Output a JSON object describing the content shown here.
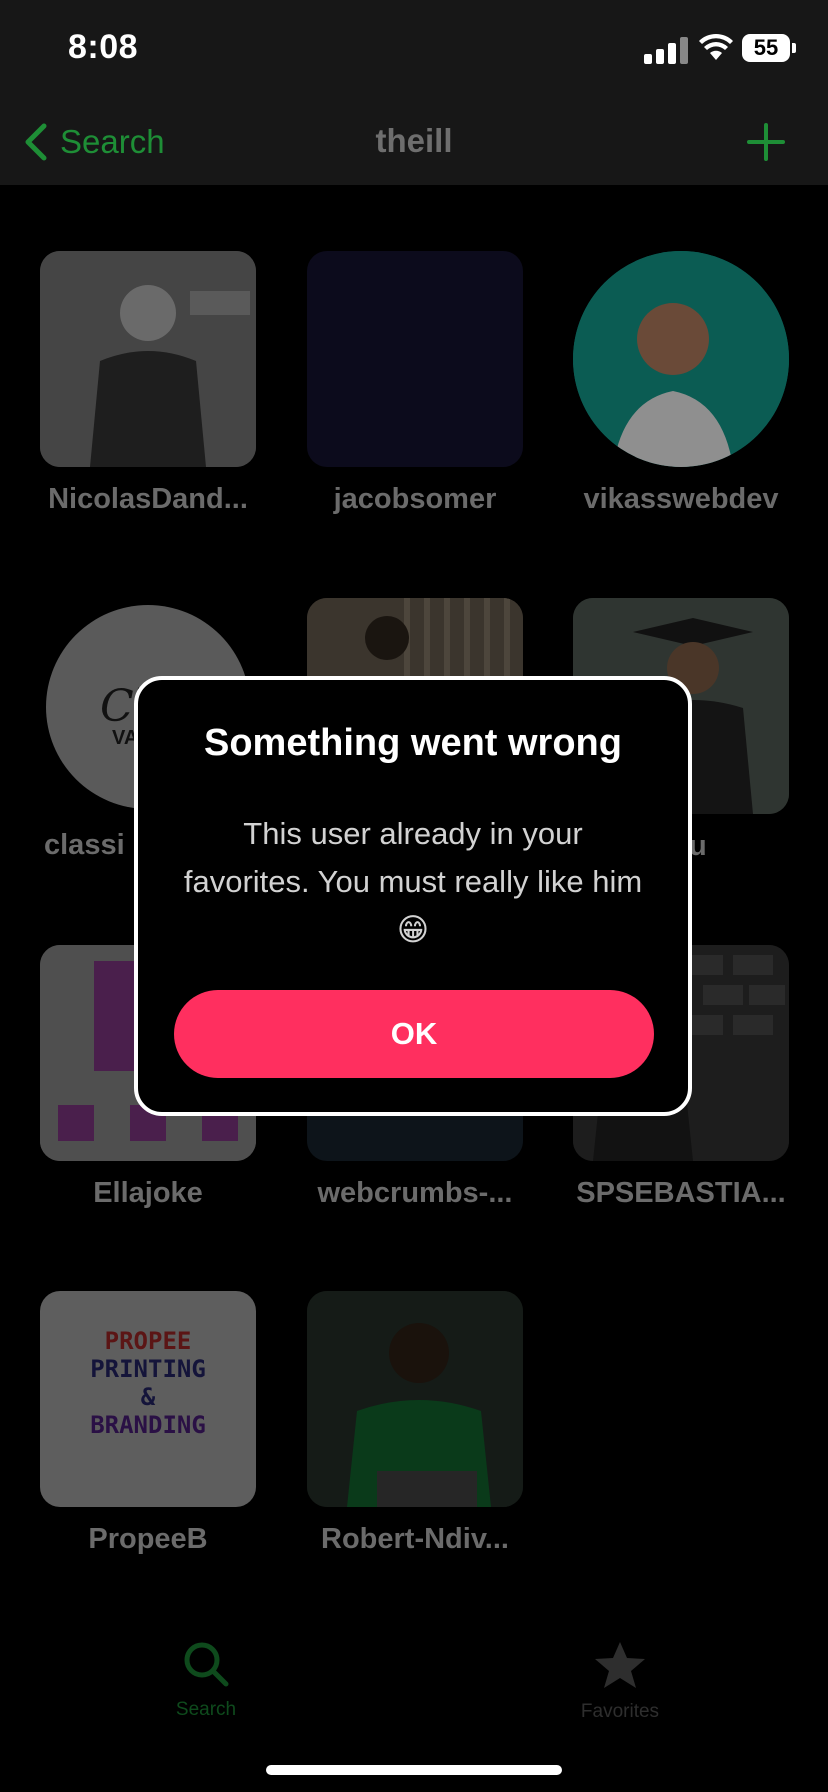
{
  "status_bar": {
    "time": "8:08",
    "battery": "55"
  },
  "nav": {
    "back_label": "Search",
    "title": "theill"
  },
  "users": [
    {
      "name": "NicolasDand..."
    },
    {
      "name": "jacobsomer"
    },
    {
      "name": "vikasswebdev"
    },
    {
      "name": "classi"
    },
    {
      "name": ""
    },
    {
      "name": "iitju"
    },
    {
      "name": "Ellajoke"
    },
    {
      "name": "webcrumbs-..."
    },
    {
      "name": "SPSEBASTIA..."
    },
    {
      "name": "PropeeB"
    },
    {
      "name": "Robert-Ndiv..."
    }
  ],
  "logo_texts": {
    "classic": "Cl",
    "classic_sub": "VA",
    "propee_line1": "PROPEE",
    "propee_line2": "PRINTING",
    "propee_line3": "&",
    "propee_line4": "BRANDING"
  },
  "dialog": {
    "title": "Something went wrong",
    "message": "This user already in your favorites. You must really like him 😁",
    "ok_label": "OK"
  },
  "tabs": [
    {
      "label": "Search",
      "icon": "search-icon"
    },
    {
      "label": "Favorites",
      "icon": "star-icon"
    }
  ],
  "colors": {
    "accent_green": "#1e8e36",
    "ok_button": "#ff2f5f"
  }
}
